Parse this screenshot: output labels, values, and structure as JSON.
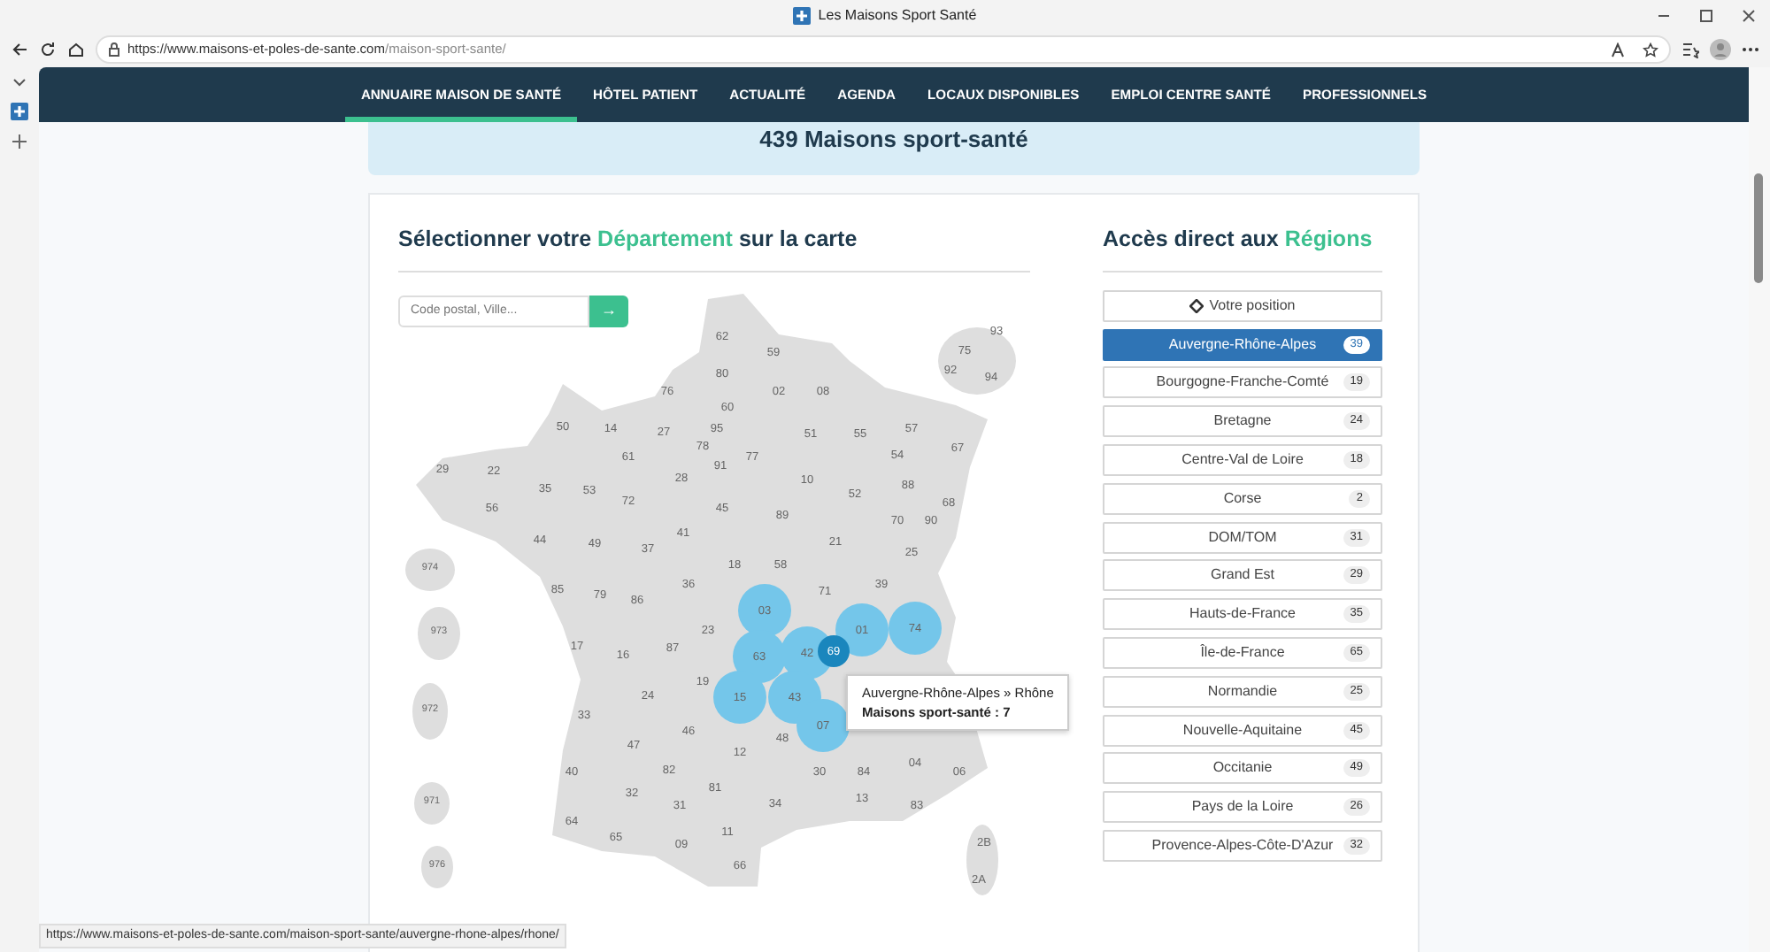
{
  "browser": {
    "tab_title": "Les Maisons Sport Santé",
    "url_host": "https://www.maisons-et-poles-de-sante.com",
    "url_path": "/maison-sport-sante/",
    "status_url": "https://www.maisons-et-poles-de-sante.com/maison-sport-sante/auvergne-rhone-alpes/rhone/"
  },
  "nav": [
    {
      "label": "ANNUAIRE MAISON DE SANTÉ",
      "selected": true
    },
    {
      "label": "HÔTEL PATIENT",
      "selected": false
    },
    {
      "label": "ACTUALITÉ",
      "selected": false
    },
    {
      "label": "AGENDA",
      "selected": false
    },
    {
      "label": "LOCAUX DISPONIBLES",
      "selected": false
    },
    {
      "label": "EMPLOI CENTRE SANTÉ",
      "selected": false
    },
    {
      "label": "PROFESSIONNELS",
      "selected": false
    }
  ],
  "banner": "439 Maisons sport-santé",
  "map_section": {
    "title_before": "Sélectionner votre ",
    "title_accent": "Département",
    "title_after": " sur la carte",
    "search_placeholder": "Code postal, Ville...",
    "search_button": "→",
    "departments": [
      {
        "label": "62",
        "in_region": false,
        "selected": false
      },
      {
        "label": "59",
        "in_region": false,
        "selected": false
      },
      {
        "label": "80",
        "in_region": false,
        "selected": false
      },
      {
        "label": "76",
        "in_region": false,
        "selected": false
      },
      {
        "label": "02",
        "in_region": false,
        "selected": false
      },
      {
        "label": "08",
        "in_region": false,
        "selected": false
      },
      {
        "label": "60",
        "in_region": false,
        "selected": false
      },
      {
        "label": "50",
        "in_region": false,
        "selected": false
      },
      {
        "label": "14",
        "in_region": false,
        "selected": false
      },
      {
        "label": "27",
        "in_region": false,
        "selected": false
      },
      {
        "label": "95",
        "in_region": false,
        "selected": false
      },
      {
        "label": "51",
        "in_region": false,
        "selected": false
      },
      {
        "label": "55",
        "in_region": false,
        "selected": false
      },
      {
        "label": "57",
        "in_region": false,
        "selected": false
      },
      {
        "label": "78",
        "in_region": false,
        "selected": false
      },
      {
        "label": "61",
        "in_region": false,
        "selected": false
      },
      {
        "label": "67",
        "in_region": false,
        "selected": false
      },
      {
        "label": "29",
        "in_region": false,
        "selected": false
      },
      {
        "label": "22",
        "in_region": false,
        "selected": false
      },
      {
        "label": "91",
        "in_region": false,
        "selected": false
      },
      {
        "label": "77",
        "in_region": false,
        "selected": false
      },
      {
        "label": "54",
        "in_region": false,
        "selected": false
      },
      {
        "label": "28",
        "in_region": false,
        "selected": false
      },
      {
        "label": "10",
        "in_region": false,
        "selected": false
      },
      {
        "label": "88",
        "in_region": false,
        "selected": false
      },
      {
        "label": "35",
        "in_region": false,
        "selected": false
      },
      {
        "label": "53",
        "in_region": false,
        "selected": false
      },
      {
        "label": "72",
        "in_region": false,
        "selected": false
      },
      {
        "label": "52",
        "in_region": false,
        "selected": false
      },
      {
        "label": "68",
        "in_region": false,
        "selected": false
      },
      {
        "label": "56",
        "in_region": false,
        "selected": false
      },
      {
        "label": "45",
        "in_region": false,
        "selected": false
      },
      {
        "label": "89",
        "in_region": false,
        "selected": false
      },
      {
        "label": "70",
        "in_region": false,
        "selected": false
      },
      {
        "label": "90",
        "in_region": false,
        "selected": false
      },
      {
        "label": "41",
        "in_region": false,
        "selected": false
      },
      {
        "label": "44",
        "in_region": false,
        "selected": false
      },
      {
        "label": "49",
        "in_region": false,
        "selected": false
      },
      {
        "label": "21",
        "in_region": false,
        "selected": false
      },
      {
        "label": "37",
        "in_region": false,
        "selected": false
      },
      {
        "label": "25",
        "in_region": false,
        "selected": false
      },
      {
        "label": "18",
        "in_region": false,
        "selected": false
      },
      {
        "label": "58",
        "in_region": false,
        "selected": false
      },
      {
        "label": "36",
        "in_region": false,
        "selected": false
      },
      {
        "label": "71",
        "in_region": false,
        "selected": false
      },
      {
        "label": "39",
        "in_region": false,
        "selected": false
      },
      {
        "label": "85",
        "in_region": false,
        "selected": false
      },
      {
        "label": "79",
        "in_region": false,
        "selected": false
      },
      {
        "label": "86",
        "in_region": false,
        "selected": false
      },
      {
        "label": "03",
        "in_region": true,
        "selected": false
      },
      {
        "label": "01",
        "in_region": true,
        "selected": false
      },
      {
        "label": "74",
        "in_region": true,
        "selected": false
      },
      {
        "label": "17",
        "in_region": false,
        "selected": false
      },
      {
        "label": "16",
        "in_region": false,
        "selected": false
      },
      {
        "label": "87",
        "in_region": false,
        "selected": false
      },
      {
        "label": "23",
        "in_region": false,
        "selected": false
      },
      {
        "label": "63",
        "in_region": true,
        "selected": false
      },
      {
        "label": "42",
        "in_region": true,
        "selected": false
      },
      {
        "label": "69",
        "in_region": true,
        "selected": true
      },
      {
        "label": "19",
        "in_region": false,
        "selected": false
      },
      {
        "label": "24",
        "in_region": false,
        "selected": false
      },
      {
        "label": "15",
        "in_region": true,
        "selected": false
      },
      {
        "label": "43",
        "in_region": true,
        "selected": false
      },
      {
        "label": "33",
        "in_region": false,
        "selected": false
      },
      {
        "label": "46",
        "in_region": false,
        "selected": false
      },
      {
        "label": "07",
        "in_region": true,
        "selected": false
      },
      {
        "label": "47",
        "in_region": false,
        "selected": false
      },
      {
        "label": "12",
        "in_region": false,
        "selected": false
      },
      {
        "label": "48",
        "in_region": false,
        "selected": false
      },
      {
        "label": "40",
        "in_region": false,
        "selected": false
      },
      {
        "label": "82",
        "in_region": false,
        "selected": false
      },
      {
        "label": "30",
        "in_region": false,
        "selected": false
      },
      {
        "label": "84",
        "in_region": false,
        "selected": false
      },
      {
        "label": "04",
        "in_region": false,
        "selected": false
      },
      {
        "label": "06",
        "in_region": false,
        "selected": false
      },
      {
        "label": "32",
        "in_region": false,
        "selected": false
      },
      {
        "label": "81",
        "in_region": false,
        "selected": false
      },
      {
        "label": "31",
        "in_region": false,
        "selected": false
      },
      {
        "label": "34",
        "in_region": false,
        "selected": false
      },
      {
        "label": "13",
        "in_region": false,
        "selected": false
      },
      {
        "label": "83",
        "in_region": false,
        "selected": false
      },
      {
        "label": "64",
        "in_region": false,
        "selected": false
      },
      {
        "label": "65",
        "in_region": false,
        "selected": false
      },
      {
        "label": "09",
        "in_region": false,
        "selected": false
      },
      {
        "label": "11",
        "in_region": false,
        "selected": false
      },
      {
        "label": "66",
        "in_region": false,
        "selected": false
      },
      {
        "label": "2B",
        "in_region": false,
        "selected": false
      },
      {
        "label": "2A",
        "in_region": false,
        "selected": false
      },
      {
        "label": "75",
        "in_region": false,
        "selected": false
      },
      {
        "label": "93",
        "in_region": false,
        "selected": false
      },
      {
        "label": "92",
        "in_region": false,
        "selected": false
      },
      {
        "label": "94",
        "in_region": false,
        "selected": false
      },
      {
        "label": "974",
        "in_region": false,
        "selected": false
      },
      {
        "label": "973",
        "in_region": false,
        "selected": false
      },
      {
        "label": "972",
        "in_region": false,
        "selected": false
      },
      {
        "label": "971",
        "in_region": false,
        "selected": false
      },
      {
        "label": "976",
        "in_region": false,
        "selected": false
      }
    ],
    "tooltip": {
      "title": "Auvergne-Rhône-Alpes » Rhône",
      "count": "Maisons sport-santé : 7"
    }
  },
  "regions_section": {
    "title_before": "Accès direct aux ",
    "title_accent": "Régions",
    "position_button": "Votre position",
    "items": [
      {
        "label": "Auvergne-Rhône-Alpes",
        "count": "39",
        "selected": true
      },
      {
        "label": "Bourgogne-Franche-Comté",
        "count": "19",
        "selected": false
      },
      {
        "label": "Bretagne",
        "count": "24",
        "selected": false
      },
      {
        "label": "Centre-Val de Loire",
        "count": "18",
        "selected": false
      },
      {
        "label": "Corse",
        "count": "2",
        "selected": false
      },
      {
        "label": "DOM/TOM",
        "count": "31",
        "selected": false
      },
      {
        "label": "Grand Est",
        "count": "29",
        "selected": false
      },
      {
        "label": "Hauts-de-France",
        "count": "35",
        "selected": false
      },
      {
        "label": "Île-de-France",
        "count": "65",
        "selected": false
      },
      {
        "label": "Normandie",
        "count": "25",
        "selected": false
      },
      {
        "label": "Nouvelle-Aquitaine",
        "count": "45",
        "selected": false
      },
      {
        "label": "Occitanie",
        "count": "49",
        "selected": false
      },
      {
        "label": "Pays de la Loire",
        "count": "26",
        "selected": false
      },
      {
        "label": "Provence-Alpes-Côte-D'Azur",
        "count": "32",
        "selected": false
      }
    ]
  }
}
